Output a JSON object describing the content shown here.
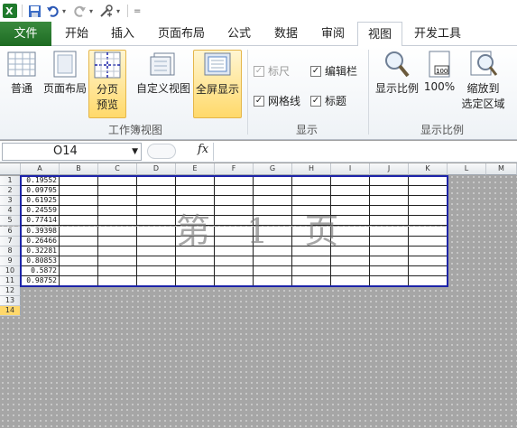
{
  "qat": {
    "more": "="
  },
  "tabs": [
    {
      "label": "文件"
    },
    {
      "label": "开始"
    },
    {
      "label": "插入"
    },
    {
      "label": "页面布局"
    },
    {
      "label": "公式"
    },
    {
      "label": "数据"
    },
    {
      "label": "审阅"
    },
    {
      "label": "视图"
    },
    {
      "label": "开发工具"
    }
  ],
  "ribbon": {
    "workbook_views": {
      "label": "工作簿视图",
      "normal": "普通",
      "page_layout": "页面布局",
      "page_break_1": "分页",
      "page_break_2": "预览",
      "custom_view": "自定义视图",
      "full_screen": "全屏显示"
    },
    "show": {
      "label": "显示",
      "ruler": "标尺",
      "gridlines": "网格线",
      "formula_bar": "编辑栏",
      "headings": "标题"
    },
    "zoom": {
      "label": "显示比例",
      "zoom": "显示比例",
      "hundred": "100%",
      "zoom_sel_1": "缩放到",
      "zoom_sel_2": "选定区域"
    }
  },
  "formula_bar": {
    "name_box": "O14",
    "fx": "fx",
    "value": ""
  },
  "sheet": {
    "columns": [
      "A",
      "B",
      "C",
      "D",
      "E",
      "F",
      "G",
      "H",
      "I",
      "J",
      "K",
      "L",
      "M"
    ],
    "rows": [
      "1",
      "2",
      "3",
      "4",
      "5",
      "6",
      "7",
      "8",
      "9",
      "10",
      "11",
      "12",
      "13",
      "14"
    ],
    "selected_row": "14",
    "column_a_values": [
      "0.19552",
      "0.09795",
      "0.61925",
      "0.24559",
      "0.77414",
      "0.39398",
      "0.26466",
      "0.32281",
      "0.80853",
      "0.5872",
      "0.98752"
    ],
    "watermark": "第 1 页"
  },
  "colors": {
    "file_tab": "#1d6b22",
    "print_border": "#1c23a8",
    "selected": "#ffd86b"
  }
}
